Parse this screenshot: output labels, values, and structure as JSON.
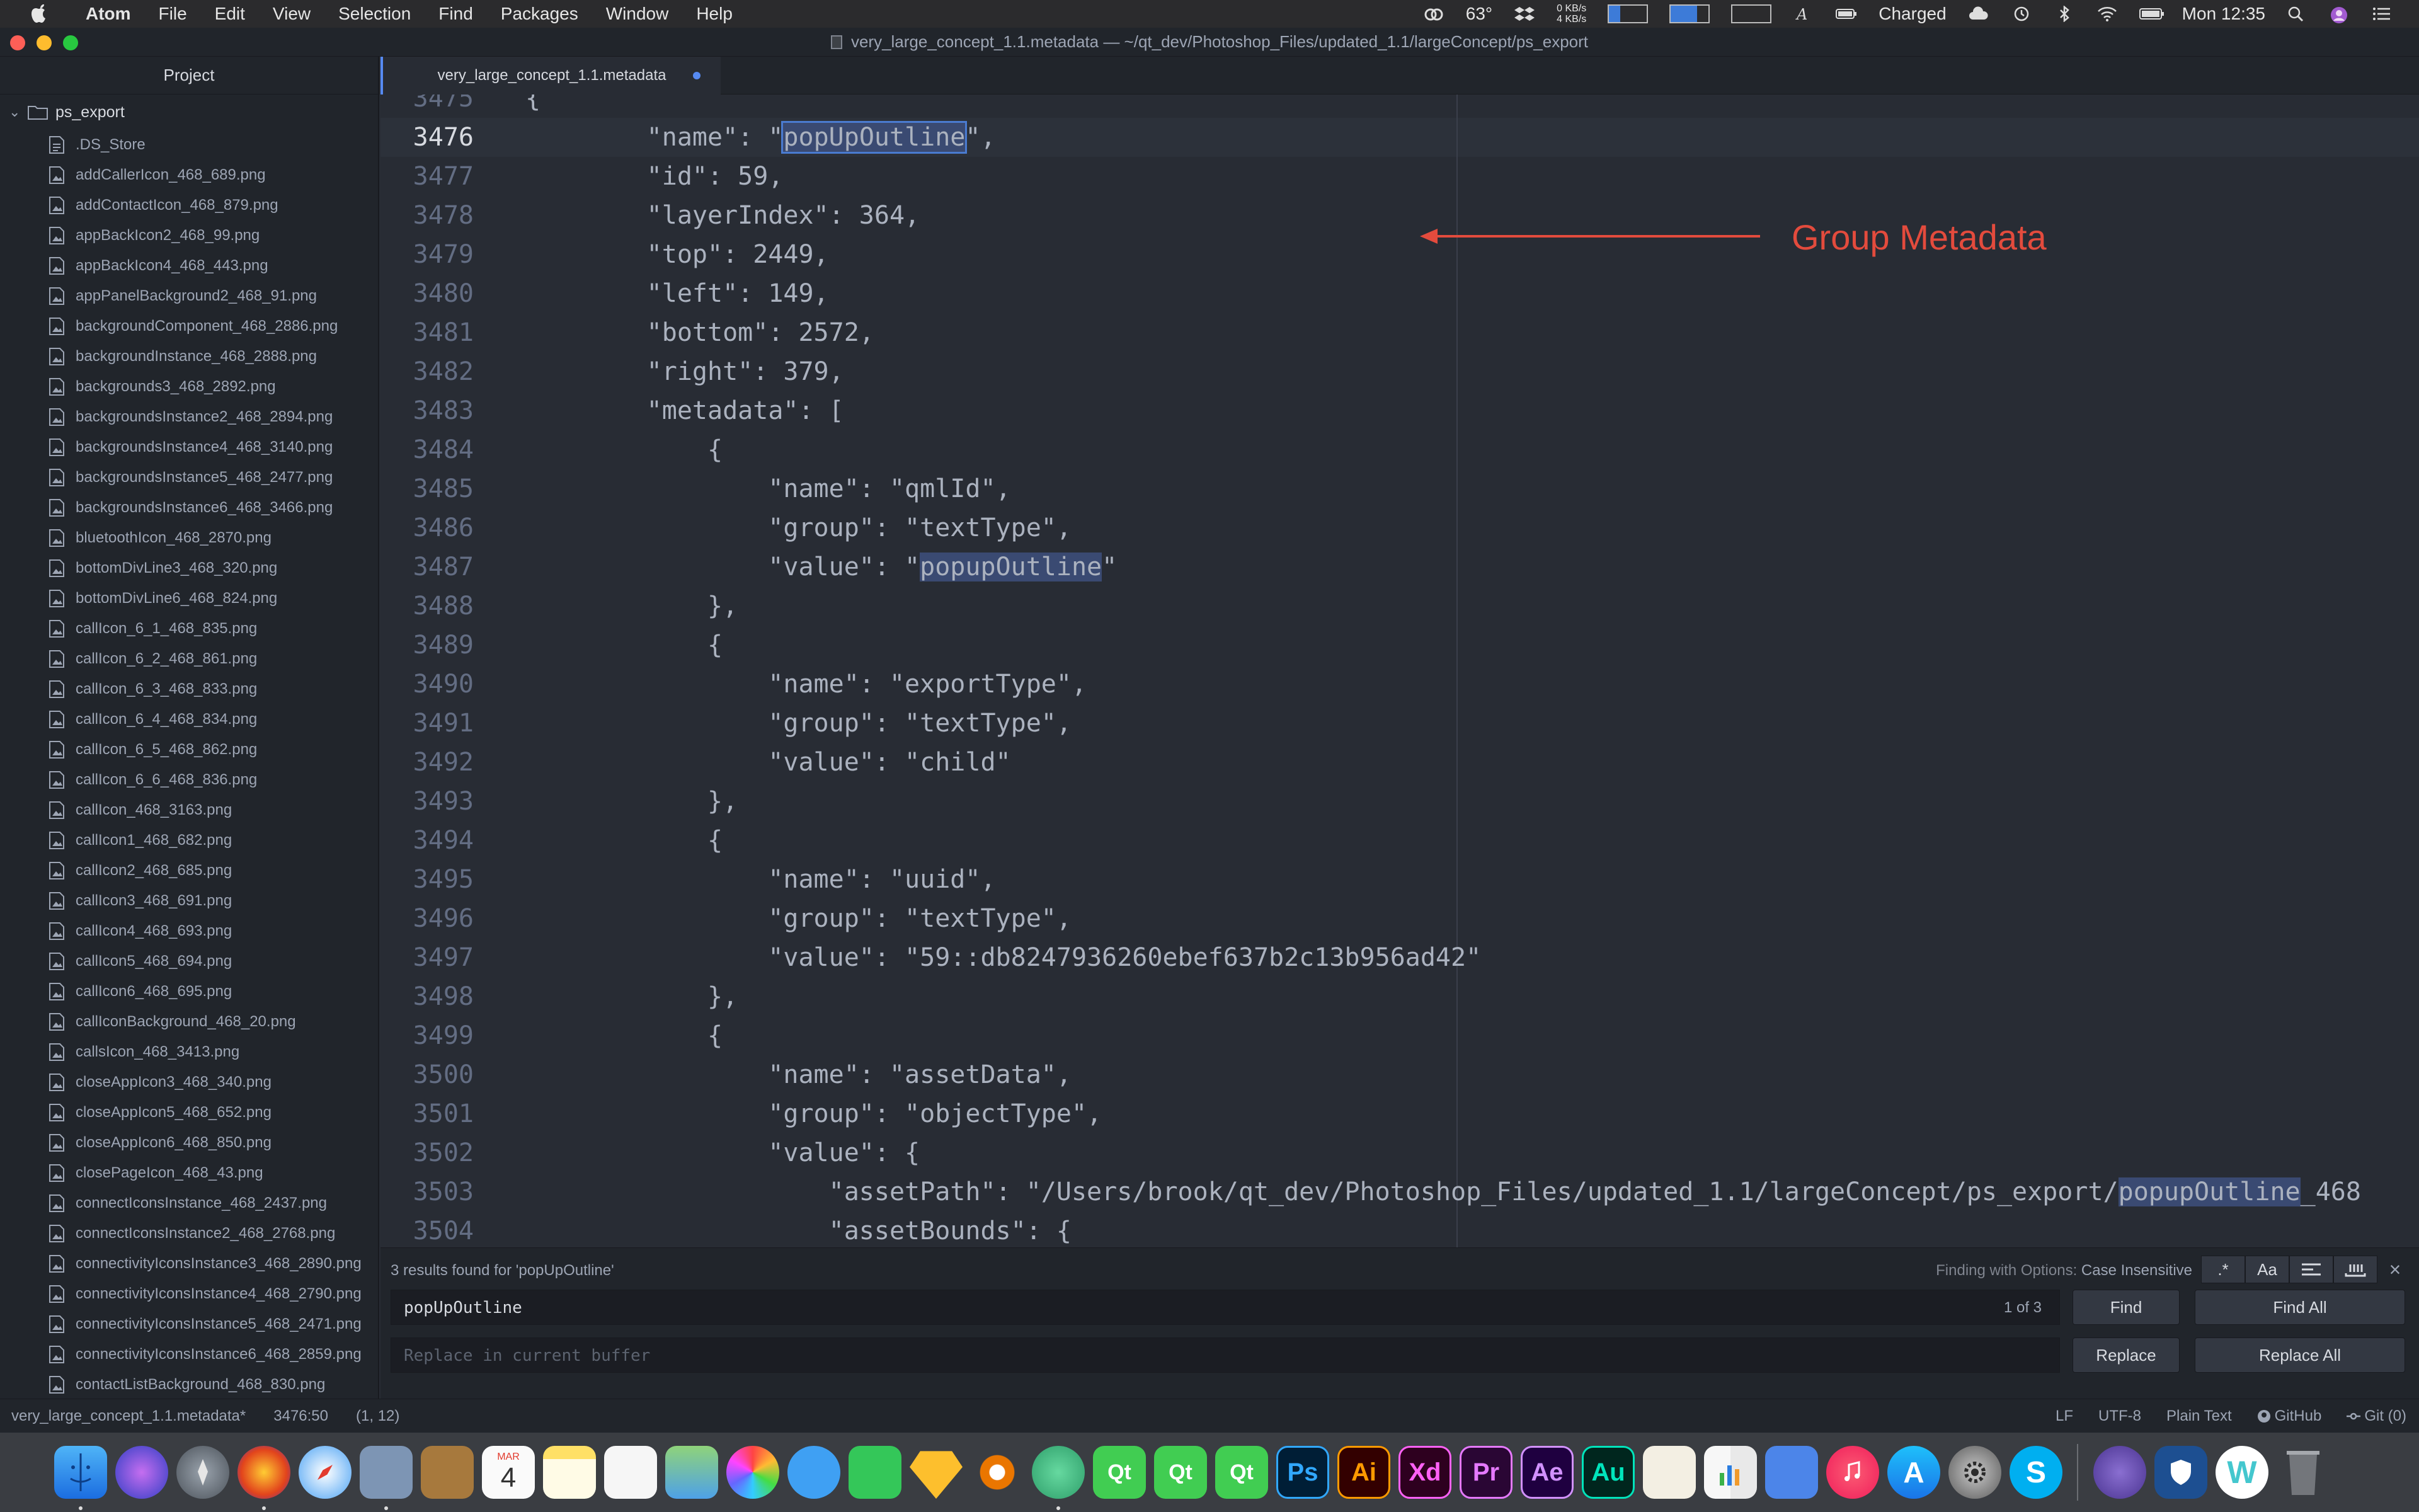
{
  "menubar": {
    "app": "Atom",
    "items": [
      "File",
      "Edit",
      "View",
      "Selection",
      "Find",
      "Packages",
      "Window",
      "Help"
    ],
    "weather": "63°",
    "net_up": "0 KB/s",
    "net_down": "4 KB/s",
    "battery_text": "Charged",
    "clock": "Mon 12:35"
  },
  "window": {
    "title": "very_large_concept_1.1.metadata — ~/qt_dev/Photoshop_Files/updated_1.1/largeConcept/ps_export"
  },
  "sidebar": {
    "header": "Project",
    "root": "ps_export",
    "files": [
      ".DS_Store",
      "addCallerIcon_468_689.png",
      "addContactIcon_468_879.png",
      "appBackIcon2_468_99.png",
      "appBackIcon4_468_443.png",
      "appPanelBackground2_468_91.png",
      "backgroundComponent_468_2886.png",
      "backgroundInstance_468_2888.png",
      "backgrounds3_468_2892.png",
      "backgroundsInstance2_468_2894.png",
      "backgroundsInstance4_468_3140.png",
      "backgroundsInstance5_468_2477.png",
      "backgroundsInstance6_468_3466.png",
      "bluetoothIcon_468_2870.png",
      "bottomDivLine3_468_320.png",
      "bottomDivLine6_468_824.png",
      "callIcon_6_1_468_835.png",
      "callIcon_6_2_468_861.png",
      "callIcon_6_3_468_833.png",
      "callIcon_6_4_468_834.png",
      "callIcon_6_5_468_862.png",
      "callIcon_6_6_468_836.png",
      "callIcon_468_3163.png",
      "callIcon1_468_682.png",
      "callIcon2_468_685.png",
      "callIcon3_468_691.png",
      "callIcon4_468_693.png",
      "callIcon5_468_694.png",
      "callIcon6_468_695.png",
      "callIconBackground_468_20.png",
      "callsIcon_468_3413.png",
      "closeAppIcon3_468_340.png",
      "closeAppIcon5_468_652.png",
      "closeAppIcon6_468_850.png",
      "closePageIcon_468_43.png",
      "connectIconsInstance_468_2437.png",
      "connectIconsInstance2_468_2768.png",
      "connectivityIconsInstance3_468_2890.png",
      "connectivityIconsInstance4_468_2790.png",
      "connectivityIconsInstance5_468_2471.png",
      "connectivityIconsInstance6_468_2859.png",
      "contactListBackground_468_830.png"
    ]
  },
  "tab": {
    "label": "very_large_concept_1.1.metadata"
  },
  "editor": {
    "partial_line_number": "3475",
    "partial_line_code": "{",
    "lines": [
      {
        "n": "3476",
        "code": "        \"name\": \"popUpOutline\","
      },
      {
        "n": "3477",
        "code": "        \"id\": 59,"
      },
      {
        "n": "3478",
        "code": "        \"layerIndex\": 364,"
      },
      {
        "n": "3479",
        "code": "        \"top\": 2449,"
      },
      {
        "n": "3480",
        "code": "        \"left\": 149,"
      },
      {
        "n": "3481",
        "code": "        \"bottom\": 2572,"
      },
      {
        "n": "3482",
        "code": "        \"right\": 379,"
      },
      {
        "n": "3483",
        "code": "        \"metadata\": ["
      },
      {
        "n": "3484",
        "code": "            {"
      },
      {
        "n": "3485",
        "code": "                \"name\": \"qmlId\","
      },
      {
        "n": "3486",
        "code": "                \"group\": \"textType\","
      },
      {
        "n": "3487",
        "code": "                \"value\": \"popupOutline\""
      },
      {
        "n": "3488",
        "code": "            },"
      },
      {
        "n": "3489",
        "code": "            {"
      },
      {
        "n": "3490",
        "code": "                \"name\": \"exportType\","
      },
      {
        "n": "3491",
        "code": "                \"group\": \"textType\","
      },
      {
        "n": "3492",
        "code": "                \"value\": \"child\""
      },
      {
        "n": "3493",
        "code": "            },"
      },
      {
        "n": "3494",
        "code": "            {"
      },
      {
        "n": "3495",
        "code": "                \"name\": \"uuid\","
      },
      {
        "n": "3496",
        "code": "                \"group\": \"textType\","
      },
      {
        "n": "3497",
        "code": "                \"value\": \"59::db8247936260ebef637b2c13b956ad42\""
      },
      {
        "n": "3498",
        "code": "            },"
      },
      {
        "n": "3499",
        "code": "            {"
      },
      {
        "n": "3500",
        "code": "                \"name\": \"assetData\","
      },
      {
        "n": "3501",
        "code": "                \"group\": \"objectType\","
      },
      {
        "n": "3502",
        "code": "                \"value\": {"
      },
      {
        "n": "3503",
        "code": "                    \"assetPath\": \"/Users/brook/qt_dev/Photoshop_Files/updated_1.1/largeConcept/ps_export/popupOutline_468"
      },
      {
        "n": "3504",
        "code": "                    \"assetBounds\": {"
      }
    ],
    "highlight_term": "popupOutline"
  },
  "annotation": {
    "label": "Group Metadata",
    "color": "#e34b3d"
  },
  "find": {
    "description": "3 results found for 'popUpOutline'",
    "options_prefix": "Finding with Options:",
    "options_value": "Case Insensitive",
    "query": "popUpOutline",
    "count": "1 of 3",
    "replace_placeholder": "Replace in current buffer",
    "find_label": "Find",
    "find_all_label": "Find All",
    "replace_label": "Replace",
    "replace_all_label": "Replace All",
    "opt_regex": ".*",
    "opt_case": "Aa"
  },
  "statusbar": {
    "file": "very_large_concept_1.1.metadata*",
    "cursor": "3476:50",
    "selection": "(1, 12)",
    "line_ending": "LF",
    "encoding": "UTF-8",
    "grammar": "Plain Text",
    "github": "GitHub",
    "git": "Git (0)"
  },
  "dock": {
    "calendar_month": "MAR",
    "calendar_day": "4",
    "labels": [
      "Qt",
      "Qt",
      "Qt",
      "Ps",
      "Ai",
      "Xd",
      "Pr",
      "Ae",
      "Au"
    ]
  },
  "colors": {
    "accent": "#568af2",
    "annotation": "#e34b3d",
    "editor_bg": "#282c34",
    "panel_bg": "#21252b"
  }
}
